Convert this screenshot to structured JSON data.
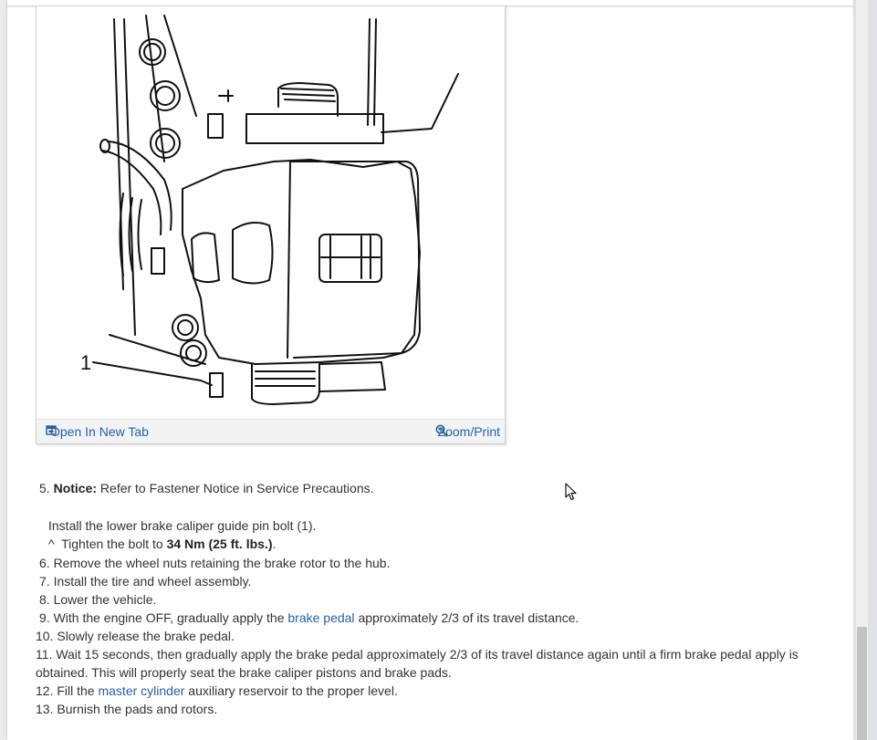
{
  "figure": {
    "callout": "1",
    "open_tab_label": "Open In New Tab",
    "zoom_label": "Zoom/Print"
  },
  "steps": {
    "s5_num": "5.",
    "s5_notice_label": "Notice:",
    "s5_text": "Refer to Fastener Notice in Service Precautions.",
    "install_text": "Install the lower brake caliper guide pin bolt (1).",
    "tighten_caret": "^",
    "tighten_pre": "Tighten the bolt to",
    "tighten_value": "34 Nm (25 ft. lbs.)",
    "tighten_post": ".",
    "s6": "6. Remove the wheel nuts retaining the brake rotor to the hub.",
    "s7": "7. Install the tire and wheel assembly.",
    "s8": "8. Lower the vehicle.",
    "s9_pre": "9. With the engine OFF, gradually apply the",
    "s9_link": "brake pedal",
    "s9_post": "approximately 2/3 of its travel distance.",
    "s10": "10. Slowly release the brake pedal.",
    "s11_line1": "11. Wait 15 seconds, then gradually apply the brake pedal approximately 2/3 of its travel distance again until a firm brake pedal apply is",
    "s11_line2": "obtained. This will properly seat the brake caliper pistons and brake pads.",
    "s12_pre": "12. Fill the",
    "s12_link": "master cylinder",
    "s12_post": "auxiliary reservoir to the proper level.",
    "s13": "13. Burnish the pads and rotors."
  },
  "icons": {
    "open_tab": "open-new-tab-icon",
    "zoom": "zoom-icon",
    "cursor": "mouse-pointer-icon"
  },
  "colors": {
    "link": "#2c5f9b",
    "text": "#333333",
    "figure_bar": "#f2f3f5"
  }
}
